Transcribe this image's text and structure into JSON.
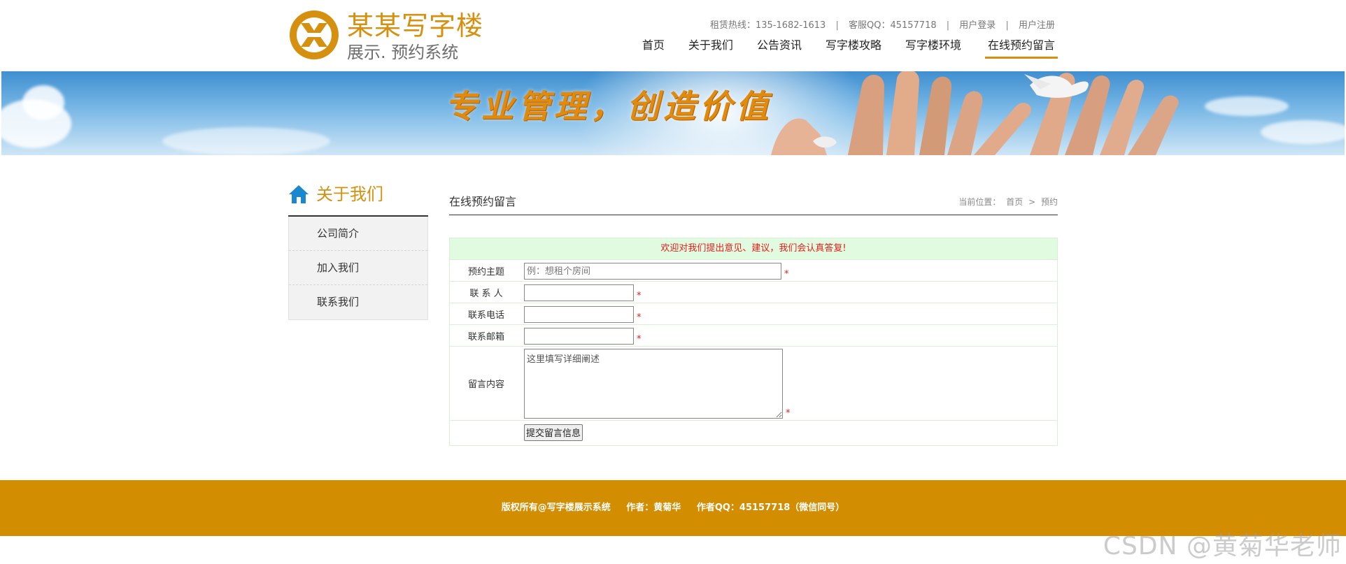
{
  "logo": {
    "title": "某某写字楼",
    "subtitle": "展示. 预约系统",
    "brand_color": "#d4900e"
  },
  "topinfo": {
    "hotline": "租赁热线：135-1682-1613",
    "qq": "客服QQ：45157718",
    "login": "用户登录",
    "register": "用户注册",
    "sep": "|"
  },
  "nav": [
    {
      "label": "首页"
    },
    {
      "label": "关于我们"
    },
    {
      "label": "公告资讯"
    },
    {
      "label": "写字楼攻略"
    },
    {
      "label": "写字楼环境"
    },
    {
      "label": "在线预约留言",
      "active": true
    }
  ],
  "banner": {
    "slogan": "专业管理，创造价值"
  },
  "sidebar": {
    "title": "关于我们",
    "icon": "home-icon",
    "items": [
      {
        "label": "公司简介"
      },
      {
        "label": "加入我们"
      },
      {
        "label": "联系我们"
      }
    ]
  },
  "main": {
    "title": "在线预约留言",
    "breadcrumb": {
      "prefix": "当前位置：",
      "home": "首页",
      "sep": ">",
      "current": "预约"
    }
  },
  "form": {
    "welcome": "欢迎对我们提出意见、建议，我们会认真答复!",
    "required_mark": "*",
    "subject_label": "预约主题",
    "subject_placeholder": "例：想租个房间",
    "contact_label": "联 系 人",
    "phone_label": "联系电话",
    "email_label": "联系邮箱",
    "content_label": "留言内容",
    "content_placeholder": "这里填写详细阐述",
    "submit_label": "提交留言信息"
  },
  "footer": {
    "copyright": "版权所有@写字楼展示系统",
    "author": "作者：黄菊华",
    "author_qq": "作者QQ：45157718（微信同号）",
    "bg_color": "#d38d00"
  },
  "watermark": "CSDN @黄菊华老师"
}
